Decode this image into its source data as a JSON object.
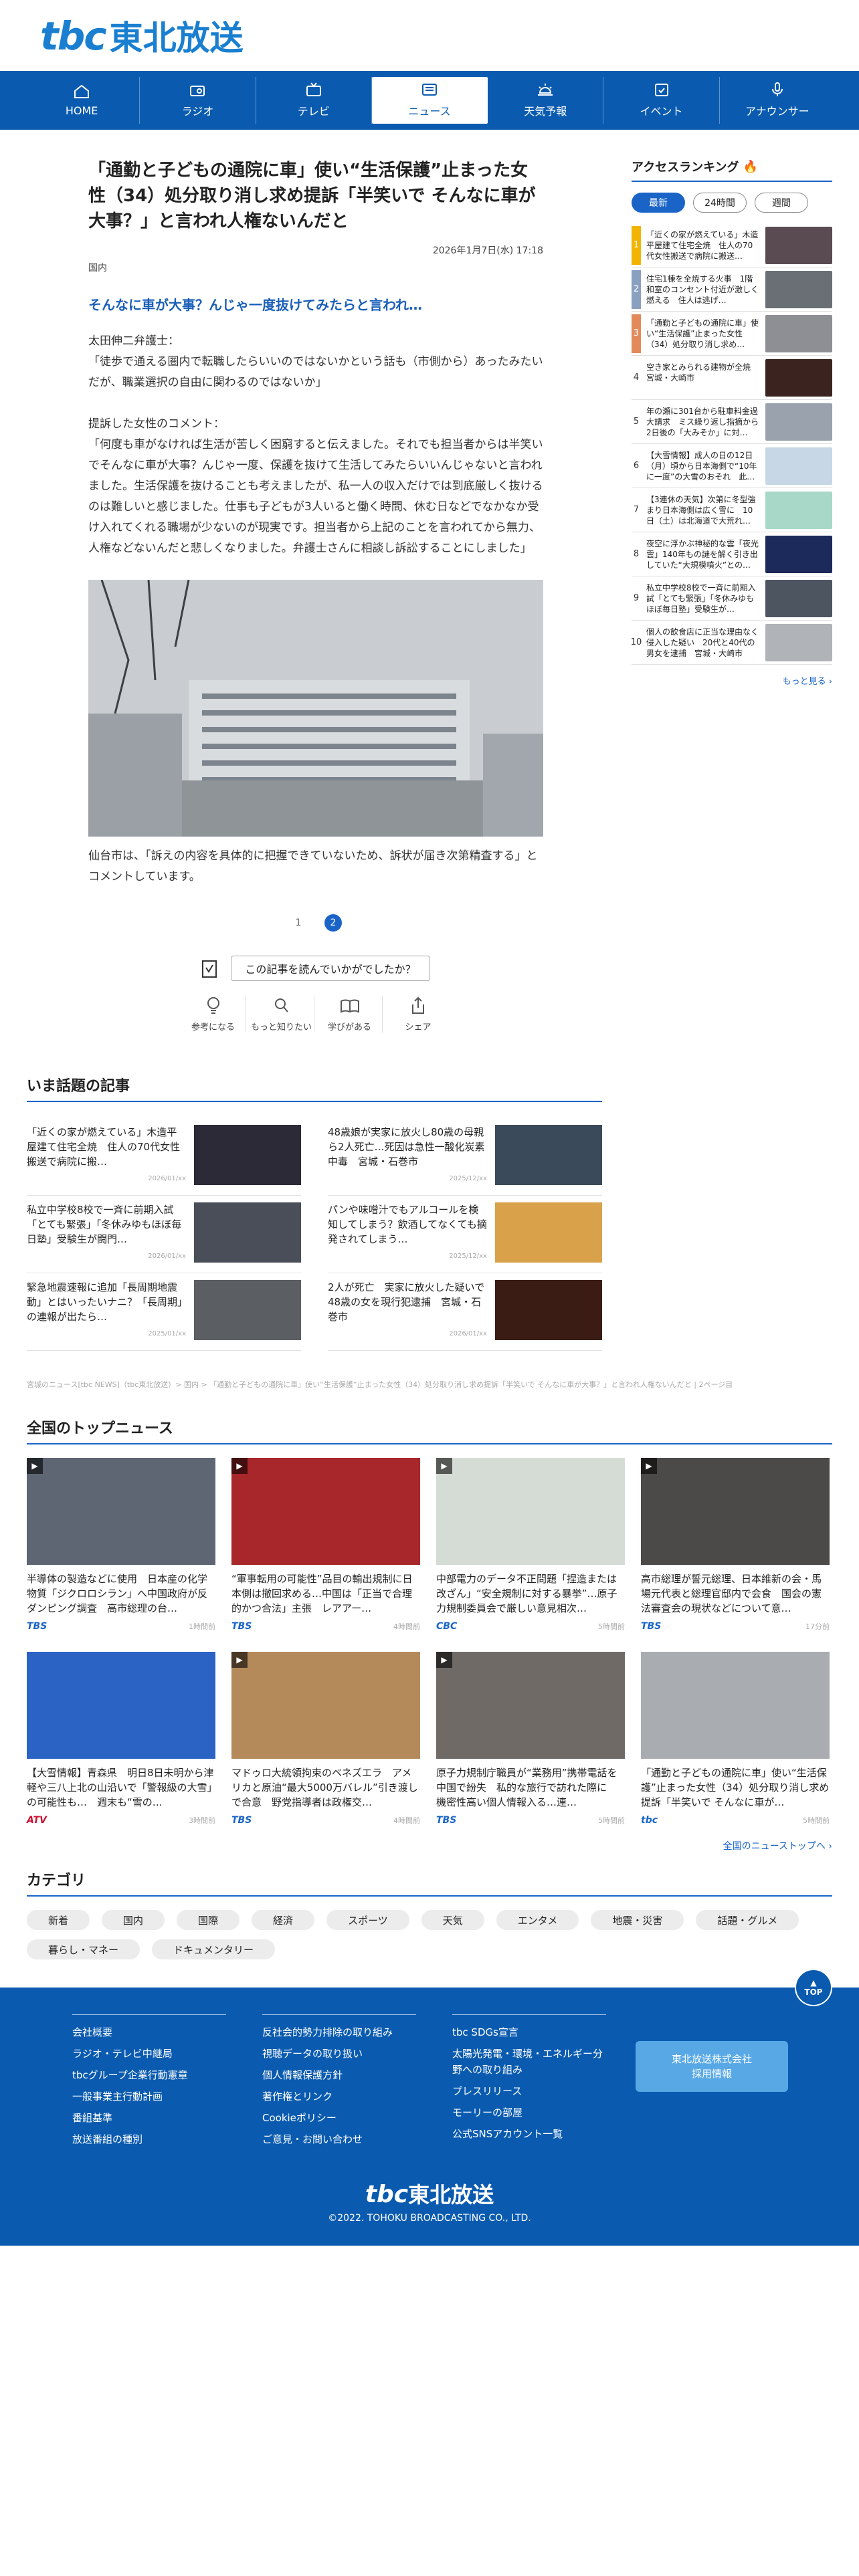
{
  "site": {
    "logo_mark": "tbc",
    "logo_name": "東北放送"
  },
  "nav": [
    "HOME",
    "ラジオ",
    "テレビ",
    "ニュース",
    "天気予報",
    "イベント",
    "アナウンサー"
  ],
  "article": {
    "title": "「通勤と子どもの通院に車」使い“生活保護”止まった女性（34）処分取り消し求め提訴「半笑いで そんなに車が大事？」と言われ人権ないんだと",
    "date": "2026年1月7日(水) 17:18",
    "category": "国内",
    "subhead": "そんなに車が大事？んじゃ一度抜けてみたらと言われ…",
    "paragraphs": [
      "太田伸二弁護士：\n「徒歩で通える圏内で転職したらいいのではないかという話も（市側から）あったみたいだが、職業選択の自由に関わるのではないか」",
      "提訴した女性のコメント：\n「何度も車がなければ生活が苦しく困窮すると伝えました。それでも担当者からは半笑いでそんなに車が大事？んじゃ一度、保護を抜けて生活してみたらいいんじゃないと言われました。生活保護を抜けることも考えましたが、私一人の収入だけでは到底厳しく抜けるのは難しいと感じました。仕事も子どもが3人いると働く時間、休む日などでなかなか受け入れてくれる職場が少ないのが現実です。担当者から上記のことを言われてから無力、人権などないんだと悲しくなりました。弁護士さんに相談し訴訟することにしました」"
    ],
    "caption": "仙台市は、「訴えの内容を具体的に把握できていないため、訴状が届き次第精査する」とコメントしています。",
    "pages": [
      "1",
      "2"
    ],
    "feedback_question": "この記事を読んでいかがでしたか？",
    "reactions": [
      "参考になる",
      "もっと知りたい",
      "学びがある",
      "シェア"
    ]
  },
  "ranking": {
    "title": "アクセスランキング",
    "tabs": [
      "最新",
      "24時間",
      "週間"
    ],
    "items": [
      {
        "no": "1",
        "text": "「近くの家が燃えている」木造平屋建て住宅全焼　住人の70代女性搬送で病院に搬送…"
      },
      {
        "no": "2",
        "text": "住宅1棟を全焼する火事　1階和室のコンセント付近が激しく燃える　住人は逃げ…"
      },
      {
        "no": "3",
        "text": "「通勤と子どもの通院に車」使い“生活保護”止まった女性（34）処分取り消し求め…"
      },
      {
        "no": "4",
        "text": "空き家とみられる建物が全焼　宮城・大崎市"
      },
      {
        "no": "5",
        "text": "年の瀬に301台から駐車料金過大請求　ミス繰り返し指摘から2日後の「大みそか」に対…"
      },
      {
        "no": "6",
        "text": "【大雪情報】成人の日の12日（月）頃から日本海側で“10年に一度”の大雪のおそれ　此…"
      },
      {
        "no": "7",
        "text": "【3連休の天気】次第に冬型強まり日本海側は広く雪に　10日（土）は北海道で大荒れ…"
      },
      {
        "no": "8",
        "text": "夜空に浮かぶ神秘的な雲「夜光雲」140年もの謎を解く引き出していた“大規模噴火”との…"
      },
      {
        "no": "9",
        "text": "私立中学校8校で一斉に前期入試「とても緊張」「冬休みゆもほぼ毎日塾」受験生が…"
      },
      {
        "no": "10",
        "text": "個人の飲食店に正当な理由なく侵入した疑い　20代と40代の男女を逮捕　宮城・大崎市"
      }
    ],
    "more": "もっと見る"
  },
  "topics": {
    "title": "いま話題の記事",
    "items": [
      {
        "text": "「近くの家が燃えている」木造平屋建て住宅全焼　住人の70代女性搬送で病院に搬…",
        "date": "2026/01/xx"
      },
      {
        "text": "48歳娘が実家に放火し80歳の母親ら2人死亡…死因は急性一酸化炭素中毒　宮城・石巻市",
        "date": "2025/12/xx"
      },
      {
        "text": "私立中学校8校で一斉に前期入試「とても緊張」「冬休みゆもほぼ毎日塾」受験生が闘門…",
        "date": "2026/01/xx"
      },
      {
        "text": "パンや味噌汁でもアルコールを検知してしまう？飲酒してなくても摘発されてしまう…",
        "date": "2025/12/xx"
      },
      {
        "text": "緊急地震速報に追加「長周期地震動」とはいったいナニ？「長周期」の連報が出たら…",
        "date": "2025/01/xx"
      },
      {
        "text": "2人が死亡　実家に放火した疑いで48歳の女を現行犯逮捕　宮城・石巻市",
        "date": "2026/01/xx"
      }
    ]
  },
  "breadcrumb": "宮城のニュース[tbc NEWS]（tbc東北放送）> 国内 > 「通勤と子どもの通院に車」使い“生活保護”止まった女性（34）処分取り消し求め提訴「半笑いで そんなに車が大事？」と言われ人権ないんだと | 2ページ目",
  "national": {
    "title": "全国のトップニュース",
    "items": [
      {
        "text": "半導体の製造などに使用　日本産の化学物質「ジクロロシラン」へ中国政府が反ダンピング調査　高市総理の台…",
        "src": "TBS",
        "time": "1時間前"
      },
      {
        "text": "“軍事転用の可能性”品目の輸出規制に日本側は撤回求める…中国は「正当で合理的かつ合法」主張　レアアー…",
        "src": "TBS",
        "time": "4時間前"
      },
      {
        "text": "中部電力のデータ不正問題「捏造または改ざん」“安全規制に対する暴挙”…原子力規制委員会で厳しい意見相次…",
        "src": "CBC",
        "time": "5時間前"
      },
      {
        "text": "高市総理が誓元総理、日本維新の会・馬場元代表と総理官邸内で会食　国会の憲法審査会の現状などについて意…",
        "src": "TBS",
        "time": "17分前"
      },
      {
        "text": "【大雪情報】青森県　明日8日未明から津軽や三八上北の山沿いで「警報級の大雪」の可能性も…　週末も“雪の…",
        "src": "ATV",
        "time": "3時間前"
      },
      {
        "text": "マドゥロ大統領拘束のベネズエラ　アメリカと原油“最大5000万バレル”引き渡しで合意　野党指導者は政権交…",
        "src": "TBS",
        "time": "4時間前"
      },
      {
        "text": "原子力規制庁職員が“業務用”携帯電話を中国で紛失　私的な旅行で訪れた際に　機密性高い個人情報入る…連…",
        "src": "TBS",
        "time": "5時間前"
      },
      {
        "text": "「通勤と子どもの通院に車」使い“生活保護”止まった女性（34）処分取り消し求め提訴「半笑いで そんなに車が…",
        "src": "tbc",
        "time": "5時間前"
      }
    ],
    "more": "全国のニューストップへ"
  },
  "categories": {
    "title": "カテゴリ",
    "items": [
      "新着",
      "国内",
      "国際",
      "経済",
      "スポーツ",
      "天気",
      "エンタメ",
      "地震・災害",
      "話題・グルメ",
      "暮らし・マネー",
      "ドキュメンタリー"
    ]
  },
  "footer": {
    "col1": [
      "会社概要",
      "ラジオ・テレビ中継局",
      "tbcグループ企業行動憲章",
      "一般事業主行動計画",
      "番組基準",
      "放送番組の種別"
    ],
    "col2": [
      "反社会的勢力排除の取り組み",
      "視聴データの取り扱い",
      "個人情報保護方針",
      "著作権とリンク",
      "Cookieポリシー",
      "ご意見・お問い合わせ"
    ],
    "col3": [
      "tbc SDGs宣言",
      "太陽光発電・環境・エネルギー分野への取り組み",
      "プレスリリース",
      "モーリーの部屋",
      "公式SNSアカウント一覧"
    ],
    "recruit": "東北放送株式会社\n採用情報",
    "to_top": "TOP",
    "copyright": "©2022. TOHOKU BROADCASTING CO., LTD."
  },
  "colors": {
    "brand": "#0a5bb0",
    "accent": "#1a64c8",
    "rank_gold": "#f2b400"
  }
}
